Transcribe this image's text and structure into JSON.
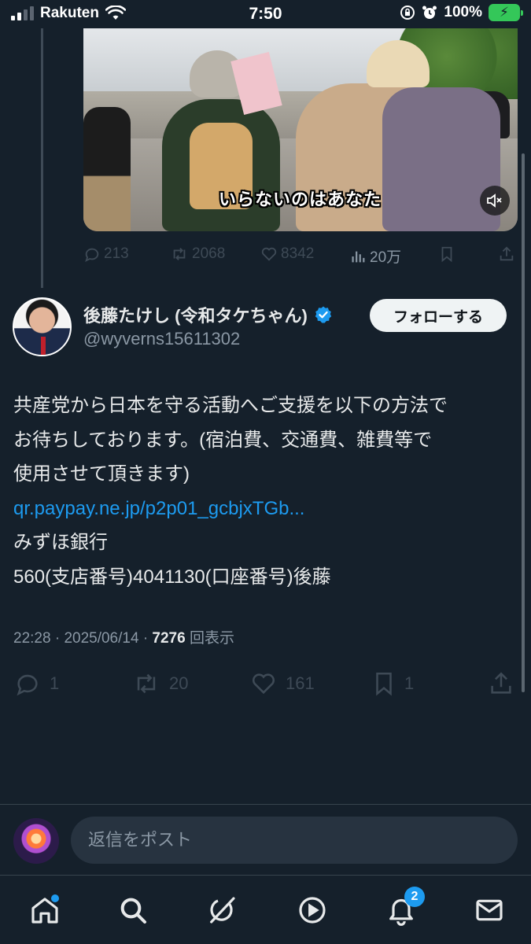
{
  "status_bar": {
    "carrier": "Rakuten",
    "time": "7:50",
    "battery": "100%"
  },
  "quoted_media": {
    "caption": "いらないのはあなた"
  },
  "quoted_stats": {
    "replies": "213",
    "retweets": "2068",
    "likes": "8342",
    "views": "20万"
  },
  "author": {
    "name": "後藤たけし (令和タケちゃん)",
    "handle": "@wyverns15611302",
    "verified": true
  },
  "follow_button": "フォローする",
  "tweet": {
    "lines": [
      "共産党から日本を守る活動へご支援を以下の方法で",
      "お待ちしております。(宿泊費、交通費、雑費等で",
      "使用させて頂きます)"
    ],
    "link": "qr.paypay.ne.jp/p2p01_gcbjxTGb...",
    "bank": "みずほ銀行",
    "account": "560(支店番号)4041130(口座番号)後藤"
  },
  "meta": {
    "time": "22:28",
    "date": "2025/06/14",
    "views_count": "7276",
    "views_label": "回表示"
  },
  "actions": {
    "replies": "1",
    "retweets": "20",
    "likes": "161",
    "bookmarks": "1"
  },
  "reply_bar": {
    "placeholder": "返信をポスト"
  },
  "nav": {
    "notifications_badge": "2",
    "icons": [
      "home-icon",
      "search-icon",
      "grok-icon",
      "video-icon",
      "bell-icon",
      "mail-icon"
    ]
  },
  "colors": {
    "background": "#15202b",
    "accent": "#1d9bf0",
    "text": "#e7e9ea",
    "muted": "#8b98a5",
    "battery": "#34c759"
  }
}
